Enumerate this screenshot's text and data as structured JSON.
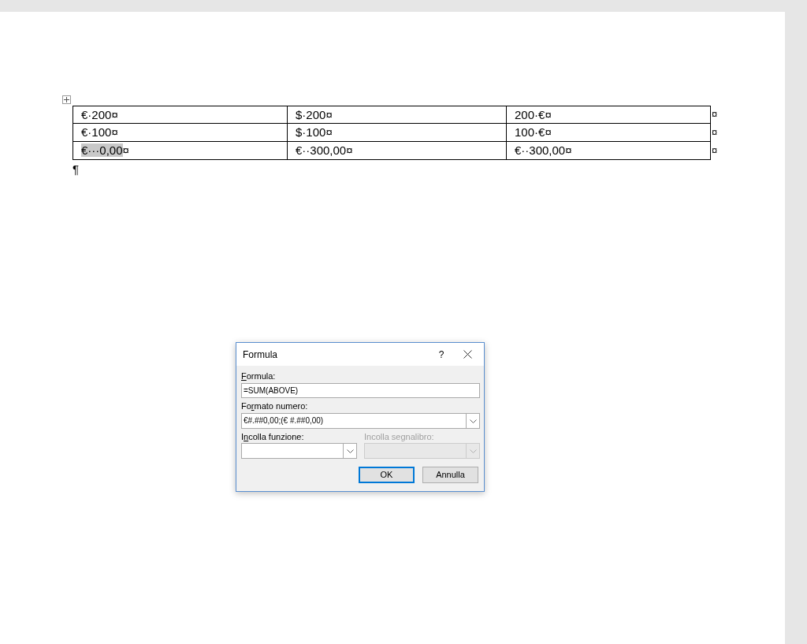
{
  "table": {
    "rows": [
      {
        "cells": [
          {
            "text": "€·200",
            "mark": "¤",
            "selected": false
          },
          {
            "text": "$·200",
            "mark": "¤",
            "selected": false
          },
          {
            "text": "200·€",
            "mark": "¤",
            "selected": false
          }
        ],
        "row_mark": "¤"
      },
      {
        "cells": [
          {
            "text": "€·100",
            "mark": "¤",
            "selected": false
          },
          {
            "text": "$·100",
            "mark": "¤",
            "selected": false
          },
          {
            "text": "100·€",
            "mark": "¤",
            "selected": false
          }
        ],
        "row_mark": "¤"
      },
      {
        "cells": [
          {
            "text": "€···0,00",
            "mark": "¤",
            "selected": true
          },
          {
            "text": "€··300,00",
            "mark": "¤",
            "selected": false
          },
          {
            "text": "€··300,00",
            "mark": "¤",
            "selected": false
          }
        ],
        "row_mark": "¤"
      }
    ]
  },
  "paragraph_mark": "¶",
  "dialog": {
    "title": "Formula",
    "help": "?",
    "formula": {
      "label": {
        "key": "F",
        "after": "ormula:"
      },
      "value": "=SUM(ABOVE)"
    },
    "number_format": {
      "label": {
        "before": "Fo",
        "key": "r",
        "after": "mato numero:"
      },
      "value": "€#.##0,00;(€ #.##0,00)"
    },
    "paste_function": {
      "label": {
        "before": "I",
        "key": "n",
        "after": "colla funzione:"
      },
      "disabled": false
    },
    "paste_bookmark": {
      "label": {
        "before": "Incolla segnalibro:"
      },
      "disabled": true
    },
    "buttons": [
      {
        "label": "OK",
        "default": true
      },
      {
        "label": "Annulla",
        "default": false
      }
    ]
  }
}
